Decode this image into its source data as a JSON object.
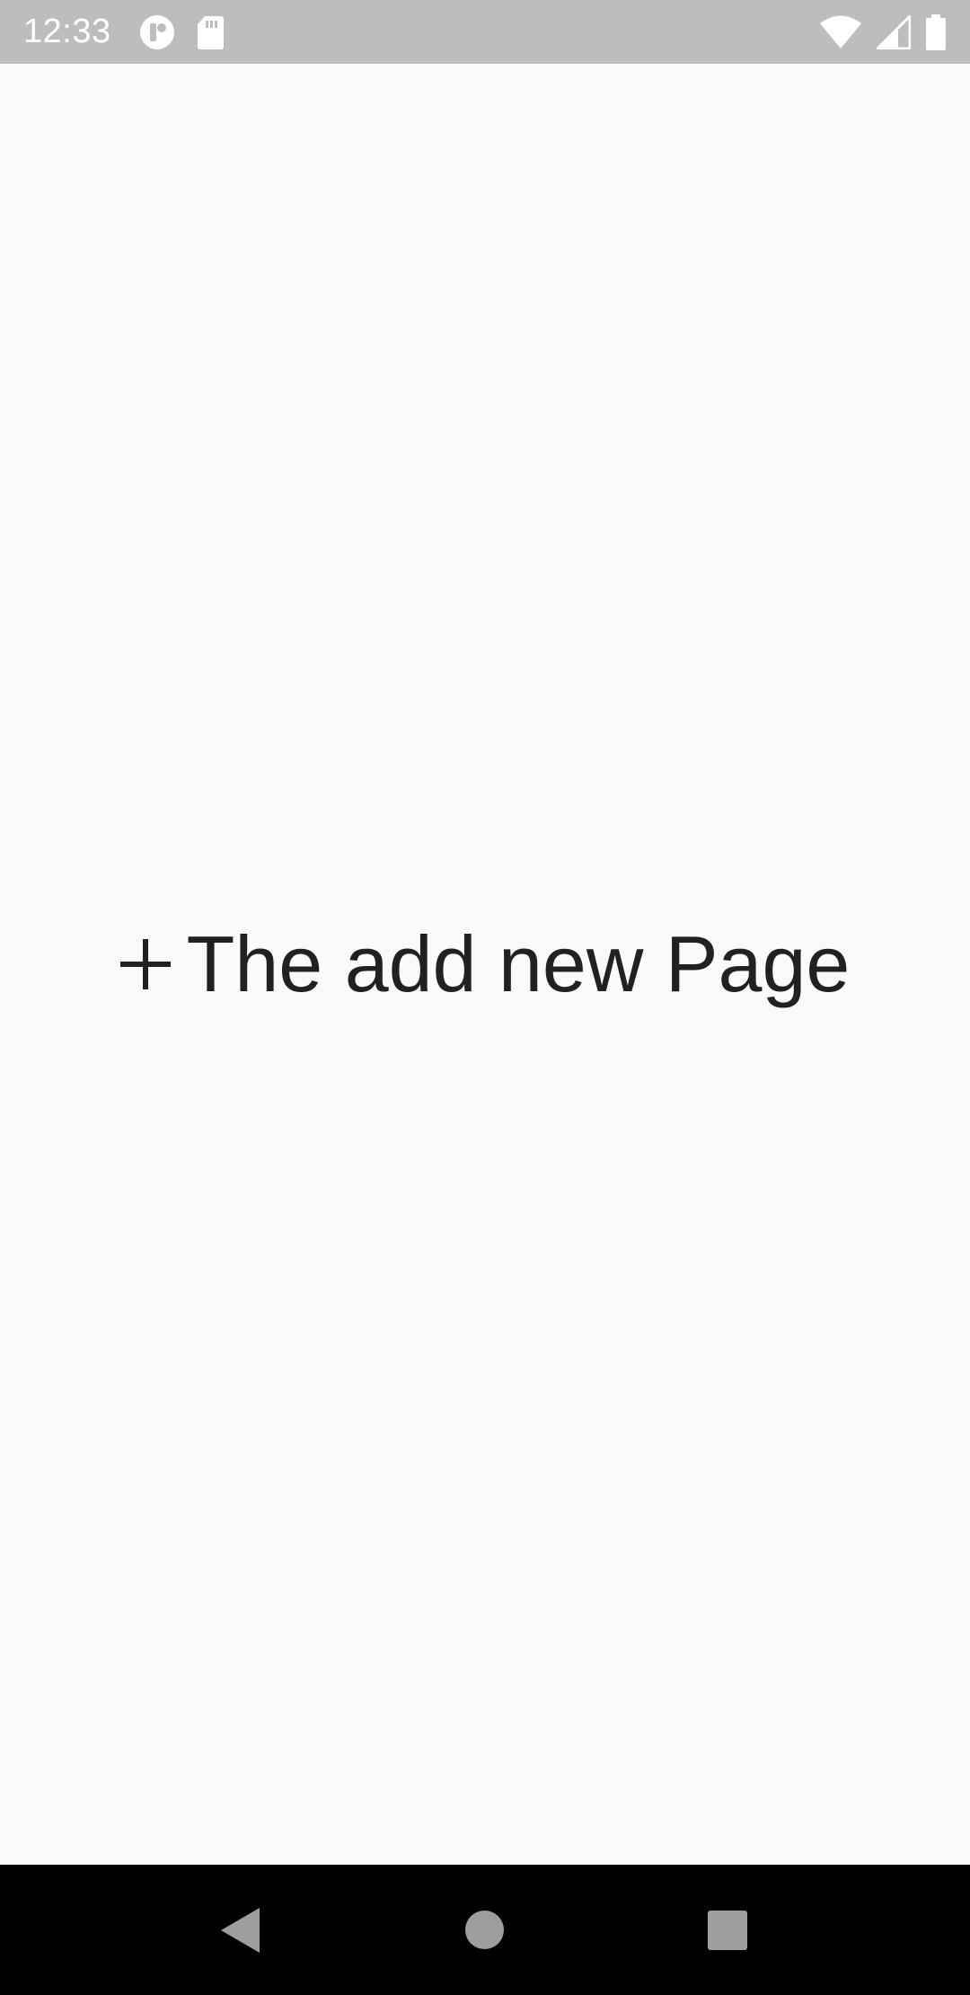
{
  "status_bar": {
    "time": "12:33",
    "left_icons": [
      "app-notification-icon",
      "sd-card-icon"
    ],
    "right_icons": [
      "wifi-icon",
      "cell-signal-icon",
      "battery-icon"
    ],
    "background_color": "#bdbdbd"
  },
  "main": {
    "add_page_label": "The add new Page",
    "add_page_icon": "plus-icon",
    "background_color": "#fafafa",
    "text_color": "#212121"
  },
  "nav_bar": {
    "buttons": [
      "back",
      "home",
      "recents"
    ],
    "background_color": "#000000",
    "icon_color": "#9e9e9e"
  }
}
